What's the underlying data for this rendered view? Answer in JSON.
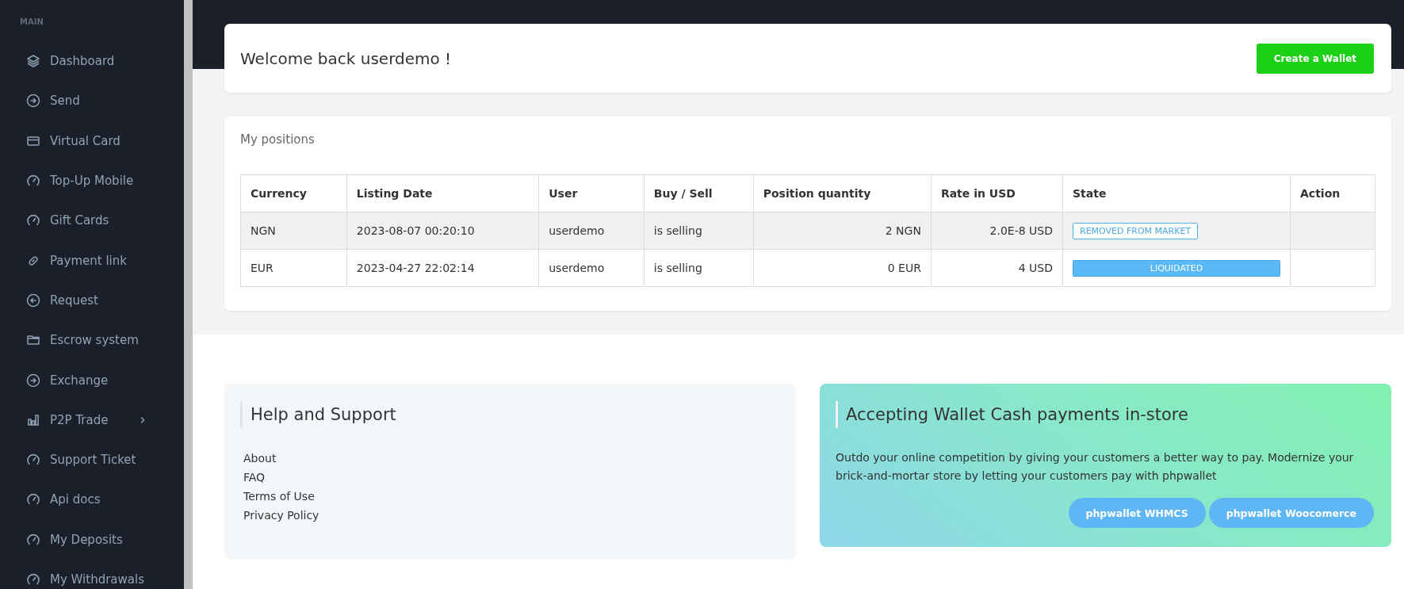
{
  "sidebar": {
    "section_label": "MAIN",
    "items": [
      {
        "label": "Dashboard",
        "expandable": false
      },
      {
        "label": "Send",
        "expandable": false
      },
      {
        "label": "Virtual Card",
        "expandable": false
      },
      {
        "label": "Top-Up Mobile",
        "expandable": false
      },
      {
        "label": "Gift Cards",
        "expandable": false
      },
      {
        "label": "Payment link",
        "expandable": false
      },
      {
        "label": "Request",
        "expandable": false
      },
      {
        "label": "Escrow system",
        "expandable": false
      },
      {
        "label": "Exchange",
        "expandable": false
      },
      {
        "label": "P2P Trade",
        "expandable": true
      },
      {
        "label": "Support Ticket",
        "expandable": false
      },
      {
        "label": "Api docs",
        "expandable": false
      },
      {
        "label": "My Deposits",
        "expandable": false
      },
      {
        "label": "My Withdrawals",
        "expandable": false
      }
    ]
  },
  "welcome": {
    "title": "Welcome back userdemo !",
    "button": "Create a Wallet"
  },
  "positions": {
    "title": "My positions",
    "columns": [
      "Currency",
      "Listing Date",
      "User",
      "Buy / Sell",
      "Position quantity",
      "Rate in USD",
      "State",
      "Action"
    ],
    "rows": [
      {
        "currency": "NGN",
        "listing_date": "2023-08-07 00:20:10",
        "user": "userdemo",
        "buy_sell": "is selling",
        "quantity": "2 NGN",
        "rate": "2.0E-8 USD",
        "state": {
          "label": "REMOVED FROM MARKET",
          "kind": "outline"
        }
      },
      {
        "currency": "EUR",
        "listing_date": "2023-04-27 22:02:14",
        "user": "userdemo",
        "buy_sell": "is selling",
        "quantity": "0 EUR",
        "rate": "4 USD",
        "state": {
          "label": "LIQUIDATED",
          "kind": "solid"
        }
      }
    ]
  },
  "help": {
    "title": "Help and Support",
    "links": [
      "About",
      "FAQ",
      "Terms of Use",
      "Privacy Policy"
    ]
  },
  "promo": {
    "title": "Accepting Wallet Cash payments in-store",
    "text": "Outdo your online competition by giving your customers a better way to pay. Modernize your brick-and-mortar store by letting your customers pay with phpwallet",
    "buttons": [
      "phpwallet WHMCS",
      "phpwallet Woocomerce"
    ]
  }
}
